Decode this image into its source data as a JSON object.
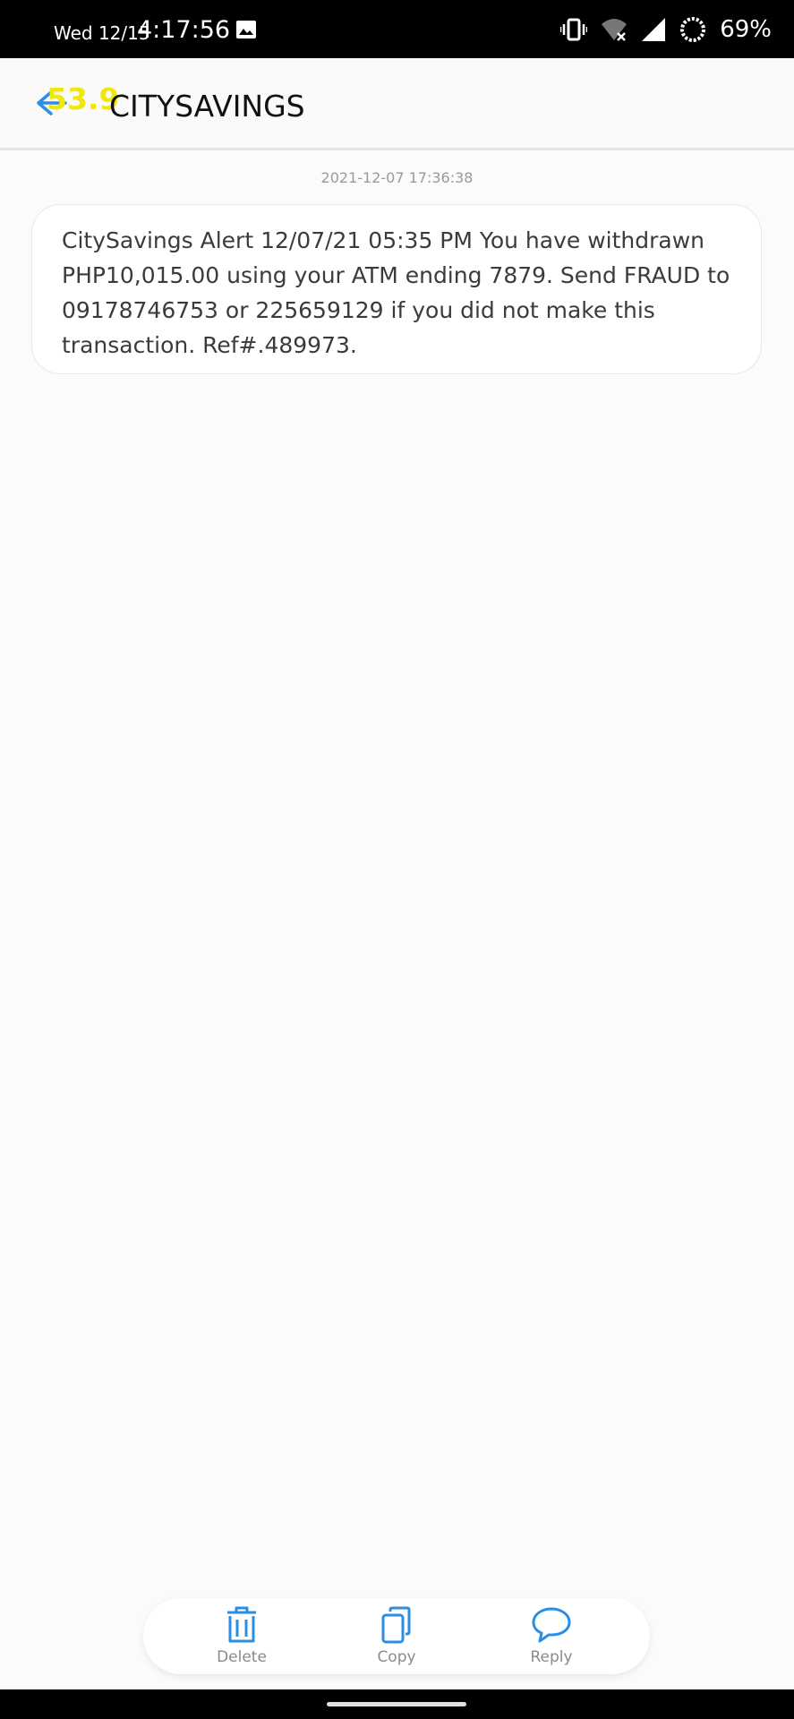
{
  "status_bar": {
    "day_date": "Wed 12/15",
    "time": "4:17:56",
    "battery_percent": "69%",
    "icons": [
      "image-icon",
      "vibrate-icon",
      "wifi-off-icon",
      "signal-icon",
      "battery-saver-icon"
    ]
  },
  "header": {
    "overlay_speed": "53.9",
    "title": "CITYSAVINGS"
  },
  "message": {
    "timestamp": "2021-12-07 17:36:38",
    "body": "CitySavings Alert 12/07/21 05:35 PM You have withdrawn PHP10,015.00 using your ATM ending 7879. Send FRAUD to 09178746753 or 225659129 if you did not make this transaction. Ref#.489973."
  },
  "actions": {
    "delete_label": "Delete",
    "copy_label": "Copy",
    "reply_label": "Reply"
  },
  "colors": {
    "accent": "#2a8ee6",
    "overlay_yellow": "#f1e80a"
  }
}
